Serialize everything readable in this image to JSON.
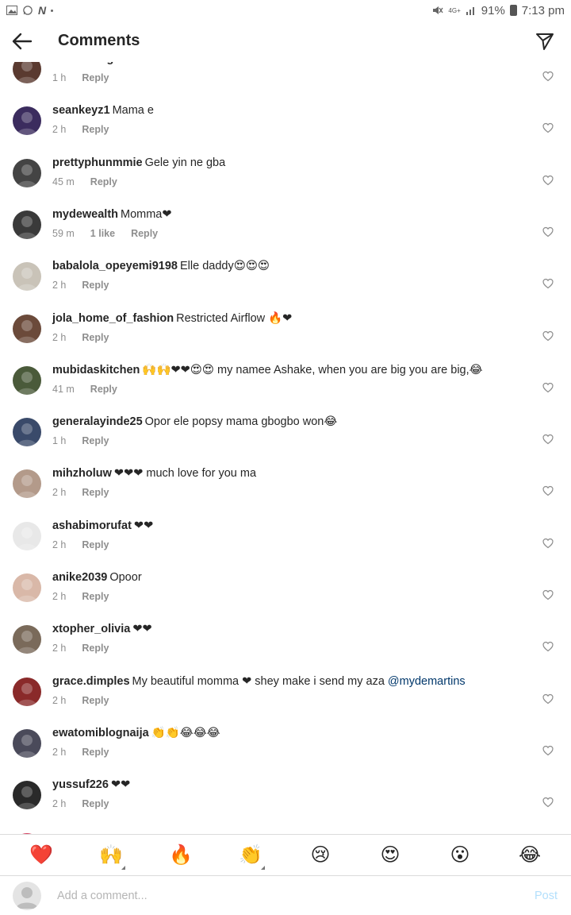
{
  "status_bar": {
    "battery": "91%",
    "time": "7:13 pm",
    "network": "4G+"
  },
  "header": {
    "title": "Comments"
  },
  "comments": [
    {
      "user": "ronkeenkighe",
      "text": "Nice one",
      "time": "1 h",
      "likes": "",
      "reply": "Reply",
      "avatar_color": "#5a3a30"
    },
    {
      "user": "seankeyz1",
      "text": "Mama e",
      "time": "2 h",
      "likes": "",
      "reply": "Reply",
      "avatar_color": "#3b2c5e"
    },
    {
      "user": "prettyphunmmie",
      "text": "Gele yin ne gba",
      "time": "45 m",
      "likes": "",
      "reply": "Reply",
      "avatar_color": "#444"
    },
    {
      "user": "mydewealth",
      "text": "Momma❤",
      "time": "59 m",
      "likes": "1 like",
      "reply": "Reply",
      "avatar_color": "#3a3a3a"
    },
    {
      "user": "babalola_opeyemi9198",
      "text": "Elle daddy😍😍😍",
      "time": "2 h",
      "likes": "",
      "reply": "Reply",
      "avatar_color": "#c9c3b8"
    },
    {
      "user": "jola_home_of_fashion",
      "text": "Restricted Airflow 🔥❤",
      "time": "2 h",
      "likes": "",
      "reply": "Reply",
      "avatar_color": "#6b4a3a"
    },
    {
      "user": "mubidaskitchen",
      "text": "🙌🙌❤❤😍😍 my namee Ashake, when you are big you are big,😂",
      "time": "41 m",
      "likes": "",
      "reply": "Reply",
      "avatar_color": "#4a5a3a"
    },
    {
      "user": "generalayinde25",
      "text": "Opor ele popsy mama gbogbo won😂",
      "time": "1 h",
      "likes": "",
      "reply": "Reply",
      "avatar_color": "#3a4a6a"
    },
    {
      "user": "mihzholuw",
      "text": "❤❤❤ much love for you ma",
      "time": "2 h",
      "likes": "",
      "reply": "Reply",
      "avatar_color": "#b39a8a"
    },
    {
      "user": "ashabimorufat",
      "text": "❤❤",
      "time": "2 h",
      "likes": "",
      "reply": "Reply",
      "avatar_color": "#e8e8e8"
    },
    {
      "user": "anike2039",
      "text": "Opoor",
      "time": "2 h",
      "likes": "",
      "reply": "Reply",
      "avatar_color": "#d9b8a8"
    },
    {
      "user": "xtopher_olivia",
      "text": "❤❤",
      "time": "2 h",
      "likes": "",
      "reply": "Reply",
      "avatar_color": "#7a6a5a"
    },
    {
      "user": "grace.dimples",
      "text": "My beautiful momma ❤ shey make i send my aza ",
      "mention": "@mydemartins",
      "time": "2 h",
      "likes": "",
      "reply": "Reply",
      "avatar_color": "#8a2a2a"
    },
    {
      "user": "ewatomiblognaija",
      "text": "👏👏😂😂😂",
      "time": "2 h",
      "likes": "",
      "reply": "Reply",
      "avatar_color": "#4a4a5a"
    },
    {
      "user": "yussuf226",
      "text": "❤❤",
      "time": "2 h",
      "likes": "",
      "reply": "Reply",
      "avatar_color": "#2a2a2a"
    }
  ],
  "emoji_bar": [
    "❤️",
    "🙌",
    "🔥",
    "👏",
    "😢",
    "😍",
    "😮",
    "😂"
  ],
  "input": {
    "placeholder": "Add a comment...",
    "post_label": "Post"
  },
  "colors": {
    "accent_post": "#b2dffc",
    "mention": "#00376b",
    "meta": "#8e8e8e"
  }
}
